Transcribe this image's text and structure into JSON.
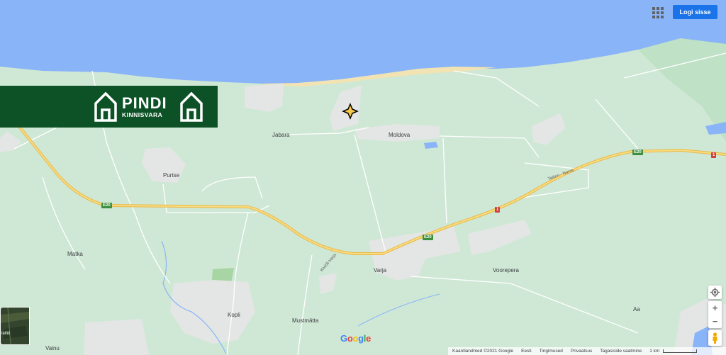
{
  "header": {
    "signin_label": "Logi sisse"
  },
  "logo": {
    "name": "PINDI",
    "sub": "KINNISVARA"
  },
  "places": {
    "jabara": "Jabara",
    "moldova": "Moldova",
    "purtse": "Purtse",
    "matka": "Matka",
    "varja": "Varja",
    "voorepera": "Voorepera",
    "kopli": "Kopli",
    "mustmatta": "Mustmätta",
    "aa": "Aa",
    "vainu": "Vainu"
  },
  "roads": {
    "e20": "E20",
    "route1": "1",
    "tallinn_narva": "Tallinn - Narva",
    "kiviola_varja": "Kiviõli-Varja"
  },
  "controls": {
    "zoom_in": "+",
    "zoom_out": "−"
  },
  "layer": {
    "label": "telliit"
  },
  "brand": {
    "g1": "G",
    "o1": "o",
    "o2": "o",
    "g2": "g",
    "l": "l",
    "e": "e"
  },
  "footer": {
    "attribution": "Kaardiandmed ©2021 Google",
    "country": "Eesti",
    "terms": "Tingimused",
    "privacy": "Privaatsus",
    "feedback": "Tagasiside saatmine",
    "scale": "1 km"
  },
  "colors": {
    "sea": "#8ab4f8",
    "land": "#cfe8d5",
    "beach": "#f2e3b3",
    "urban": "#e3e6e4",
    "road": "#f6cf65",
    "brand_green": "#0d5227"
  },
  "icons": [
    "apps-icon",
    "house-icon",
    "location-pin-icon",
    "my-location-icon",
    "pegman-icon"
  ]
}
